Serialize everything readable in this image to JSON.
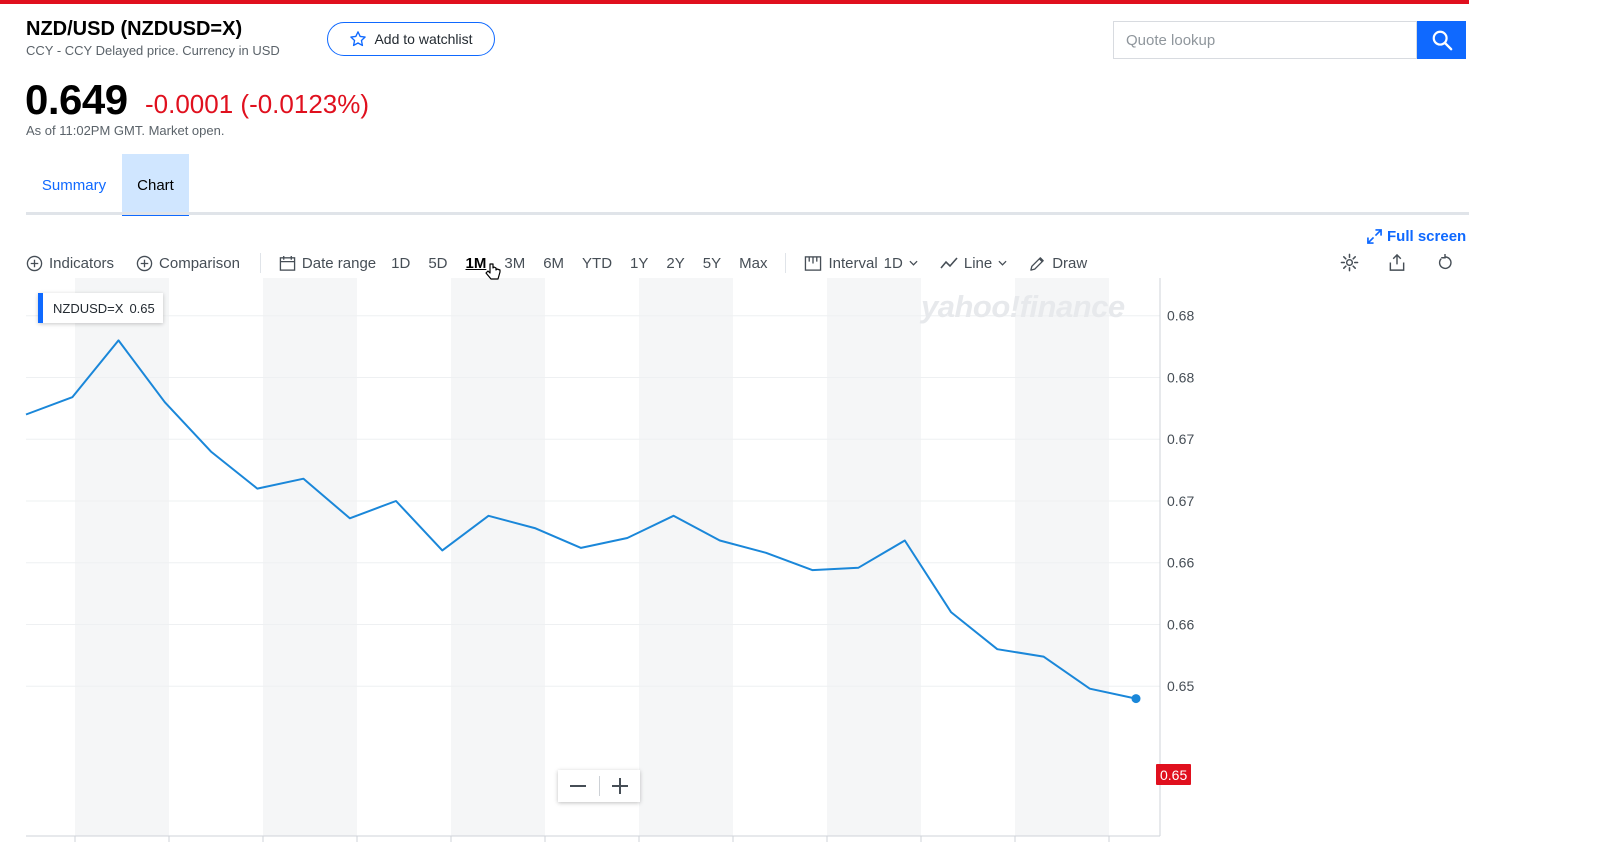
{
  "header": {
    "title": "NZD/USD (NZDUSD=X)",
    "subtitle": "CCY - CCY Delayed price. Currency in USD",
    "watchlist_label": "Add to watchlist",
    "search_placeholder": "Quote lookup"
  },
  "quote": {
    "price": "0.649",
    "change": "-0.0001 (-0.0123%)",
    "time": "As of 11:02PM GMT. Market open."
  },
  "tabs": [
    {
      "label": "Summary",
      "active": false
    },
    {
      "label": "Chart",
      "active": true
    }
  ],
  "toolbar": {
    "fullscreen_label": "Full screen",
    "indicators_label": "Indicators",
    "comparison_label": "Comparison",
    "date_range_label": "Date range",
    "ranges": [
      "1D",
      "5D",
      "1M",
      "3M",
      "6M",
      "YTD",
      "1Y",
      "2Y",
      "5Y",
      "Max"
    ],
    "active_range": "1M",
    "interval_label": "Interval",
    "interval_value": "1D",
    "chart_type_label": "Line",
    "draw_label": "Draw"
  },
  "icons": {
    "settings": "gear-icon",
    "share": "share-icon",
    "reset": "reset-icon",
    "search": "search-icon"
  },
  "colors": {
    "accent": "#0f69ff",
    "negative": "#e0101e",
    "line": "#1a87d9"
  },
  "chart": {
    "series_label": "NZDUSD=X",
    "series_value": "0.65",
    "watermark": "yahoo!finance",
    "last_price_label": "0.65"
  },
  "chart_data": {
    "type": "line",
    "y_tick_labels": [
      "0.68",
      "0.68",
      "0.67",
      "0.67",
      "0.66",
      "0.66",
      "0.65"
    ],
    "y_tick_values": [
      0.6825,
      0.68,
      0.6775,
      0.675,
      0.6725,
      0.67,
      0.6675
    ],
    "ylim": [
      0.665,
      0.6835
    ],
    "series": [
      {
        "name": "NZDUSD=X",
        "values": [
          0.6785,
          0.6792,
          0.6815,
          0.679,
          0.677,
          0.6755,
          0.6759,
          0.6743,
          0.675,
          0.673,
          0.6744,
          0.6739,
          0.6731,
          0.6735,
          0.6744,
          0.6734,
          0.6729,
          0.6722,
          0.6723,
          0.6734,
          0.6705,
          0.669,
          0.6687,
          0.6674,
          0.667
        ]
      }
    ],
    "grid": true,
    "legend": "top-left"
  }
}
